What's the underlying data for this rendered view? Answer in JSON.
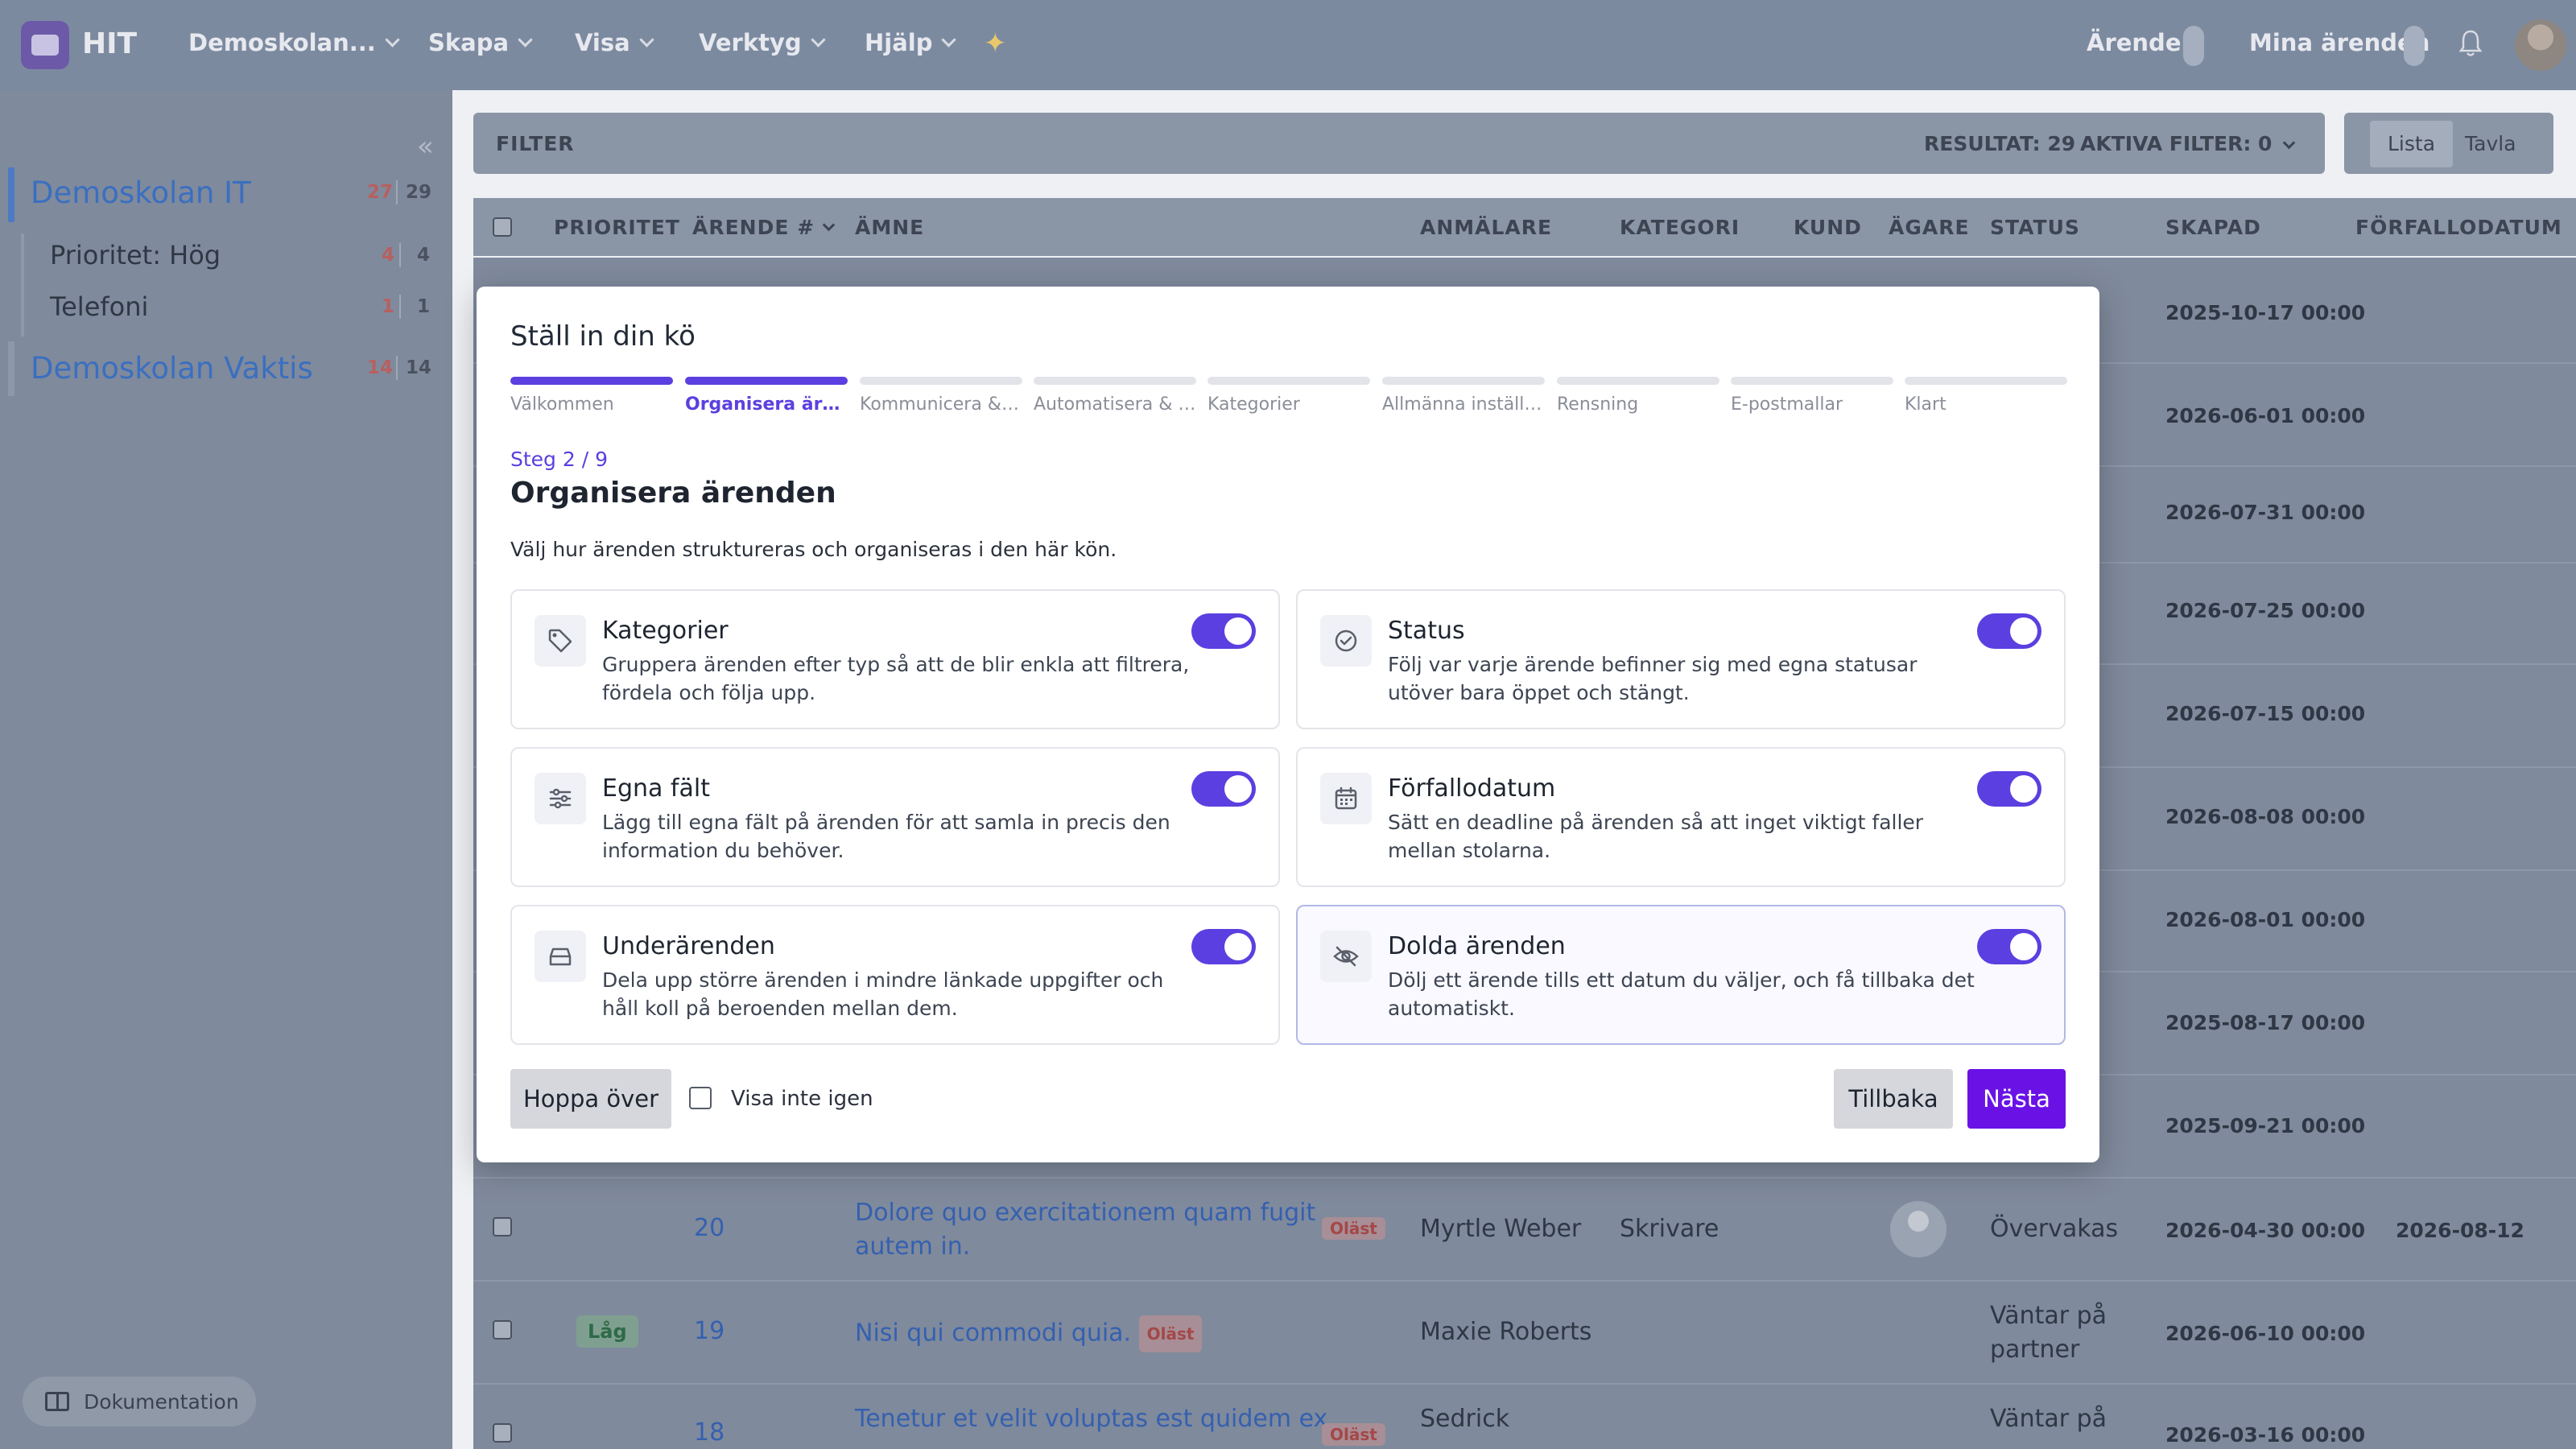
{
  "topbar": {
    "brand": "HIT",
    "nav": [
      {
        "label": "Demoskolan..."
      },
      {
        "label": "Skapa"
      },
      {
        "label": "Visa"
      },
      {
        "label": "Verktyg"
      },
      {
        "label": "Hjälp"
      }
    ],
    "tickets_link": "Ärenden",
    "my_tickets_link": "Mina ärenden",
    "icons": {
      "logo": "app-logo-icon",
      "sparkle": "sparkle-icon",
      "bell": "bell-icon",
      "avatar": "user-avatar"
    }
  },
  "sidebar": {
    "groups": [
      {
        "title": "Demoskolan IT",
        "unread": "27",
        "total": "29",
        "items": [
          {
            "label": "Prioritet: Hög",
            "unread": "4",
            "total": "4"
          },
          {
            "label": "Telefoni",
            "unread": "1",
            "total": "1"
          }
        ]
      },
      {
        "title": "Demoskolan Vaktis",
        "unread": "14",
        "total": "14",
        "items": []
      }
    ],
    "doc_button": "Dokumentation"
  },
  "filterbar": {
    "label": "FILTER",
    "results": "RESULTAT: 29",
    "active_filters": "AKTIVA FILTER: 0"
  },
  "view_toggle": {
    "list": "Lista",
    "board": "Tavla",
    "active": "Lista"
  },
  "table": {
    "headers": {
      "priority": "PRIORITET",
      "ticket": "ÄRENDE #",
      "subject": "ÄMNE",
      "reporter": "ANMÄLARE",
      "category": "KATEGORI",
      "customer": "KUND",
      "owner": "ÄGARE",
      "status": "STATUS",
      "created": "SKAPAD",
      "due": "FÖRFALLODATUM"
    },
    "created_dates": [
      "2025-10-17 00:00",
      "2026-06-01 00:00",
      "2026-07-31 00:00",
      "2026-07-25 00:00",
      "2026-07-15 00:00",
      "2026-08-08 00:00",
      "2026-08-01 00:00",
      "2025-08-17 00:00",
      "2025-09-21 00:00"
    ],
    "rows": [
      {
        "id": "20",
        "subject_1": "Dolore quo exercitationem quam fugit",
        "subject_2": "autem in.",
        "badge": "Oläst",
        "reporter": "Myrtle Weber",
        "category": "Skrivare",
        "status": "Övervakas",
        "created": "2026-04-30 00:00",
        "due": "2026-08-12"
      },
      {
        "id": "19",
        "priority": "Låg",
        "subject_1": "Nisi qui commodi quia.",
        "badge": "Oläst",
        "reporter": "Maxie Roberts",
        "status_1": "Väntar på",
        "status_2": "partner",
        "created": "2026-06-10 00:00"
      },
      {
        "id": "18",
        "subject_1": "Tenetur et velit voluptas est quidem ex",
        "badge": "Oläst",
        "reporter": "Sedrick",
        "status_1": "Väntar på",
        "created": "2026-03-16 00:00"
      }
    ]
  },
  "modal": {
    "title": "Ställ in din kö",
    "steps": [
      {
        "label": "Välkommen"
      },
      {
        "label": "Organisera ärenden"
      },
      {
        "label": "Kommunicera & samarbeta"
      },
      {
        "label": "Automatisera & analysera"
      },
      {
        "label": "Kategorier"
      },
      {
        "label": "Allmänna inställningar"
      },
      {
        "label": "Rensning"
      },
      {
        "label": "E-postmallar"
      },
      {
        "label": "Klart"
      }
    ],
    "current_step": 2,
    "step_counter": "Steg 2 / 9",
    "step_title": "Organisera ärenden",
    "step_description": "Välj hur ärenden struktureras och organiseras i den här kön.",
    "cards": [
      {
        "title": "Kategorier",
        "desc": "Gruppera ärenden efter typ så att de blir enkla att filtrera, fördela och följa upp.",
        "icon": "tag-icon",
        "enabled": true
      },
      {
        "title": "Status",
        "desc": "Följ var varje ärende befinner sig med egna statusar utöver bara öppet och stängt.",
        "icon": "check-circle-icon",
        "enabled": true
      },
      {
        "title": "Egna fält",
        "desc": "Lägg till egna fält på ärenden för att samla in precis den information du behöver.",
        "icon": "sliders-icon",
        "enabled": true
      },
      {
        "title": "Förfallodatum",
        "desc": "Sätt en deadline på ärenden så att inget viktigt faller mellan stolarna.",
        "icon": "calendar-icon",
        "enabled": true
      },
      {
        "title": "Underärenden",
        "desc": "Dela upp större ärenden i mindre länkade uppgifter och håll koll på beroenden mellan dem.",
        "icon": "inbox-icon",
        "enabled": true
      },
      {
        "title": "Dolda ärenden",
        "desc": "Dölj ett ärende tills ett datum du väljer, och få tillbaka det automatiskt.",
        "icon": "eye-off-icon",
        "enabled": true
      }
    ],
    "skip_label": "Hoppa över",
    "dont_show_label": "Visa inte igen",
    "back_label": "Tillbaka",
    "next_label": "Nästa"
  },
  "colors": {
    "accent": "#5b3fe0",
    "next_button": "#6a12e6",
    "link": "#3560b0"
  }
}
